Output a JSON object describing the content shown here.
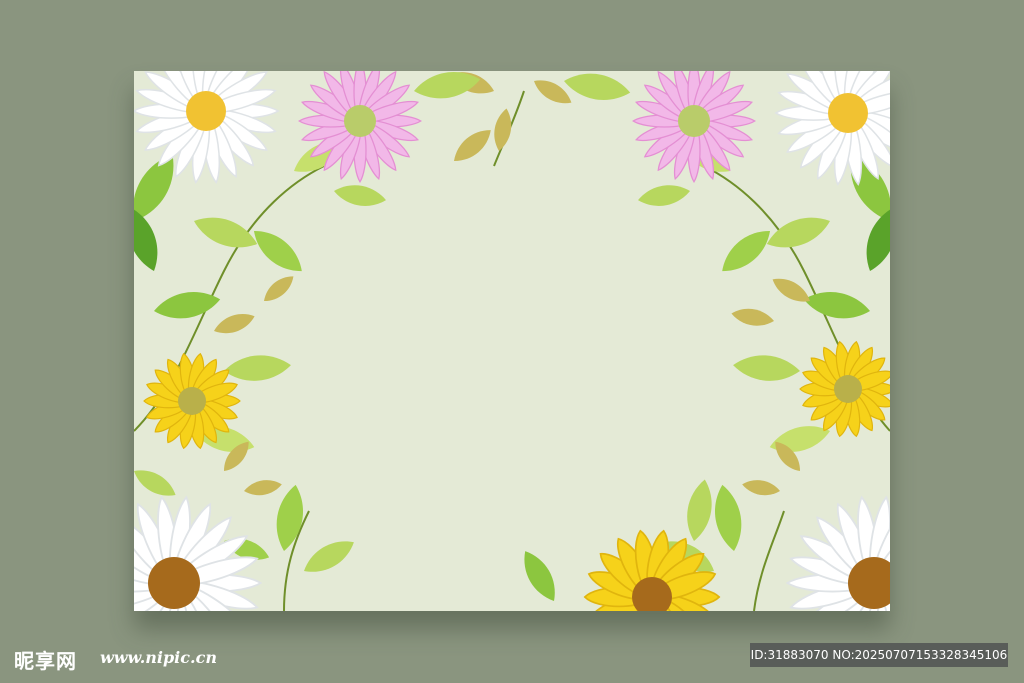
{
  "image": {
    "description_free": true,
    "background_color": "#8a957f",
    "card_color": "#e4ead6"
  },
  "watermark": {
    "logo_text": "昵享网",
    "site": "www.nipic.cn",
    "id_line": "ID:31883070 NO:20250707153328345106"
  },
  "colors": {
    "leaf_light": "#b7d75e",
    "leaf_mid": "#8cc63f",
    "leaf_dark": "#5aa32a",
    "leaf_olive": "#c9b85a",
    "daisy_white": "#ffffff",
    "daisy_pink": "#f2b8e8",
    "sunflower": "#f6d21a",
    "center_yellow": "#f1c232",
    "center_green": "#b9cc6a",
    "center_brown": "#a66a1c"
  }
}
